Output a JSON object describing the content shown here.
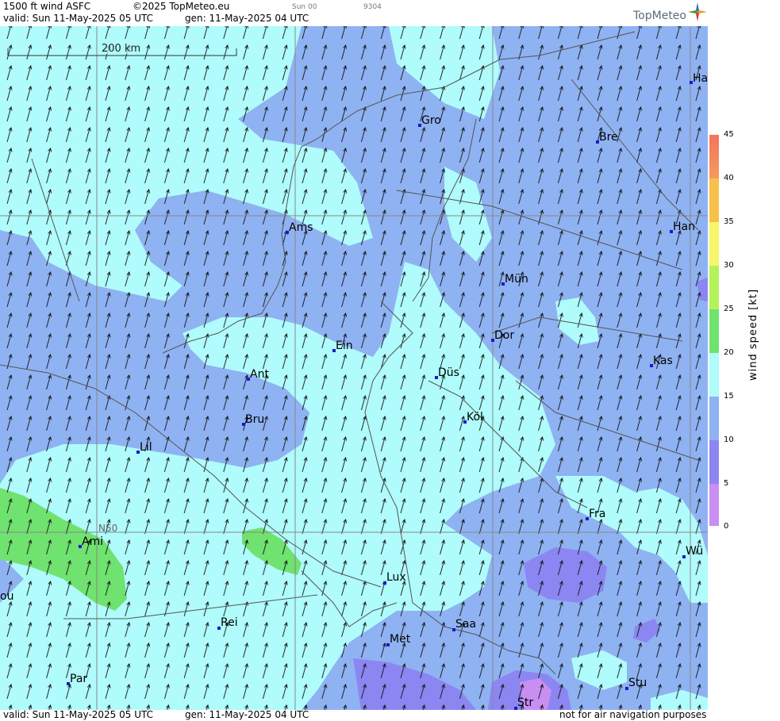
{
  "header": {
    "product": "1500 ft wind ASFC",
    "copyright": "©2025 TopMeteo.eu",
    "time_code": "Sun 00",
    "code": "9304",
    "valid": "valid:  Sun  11-May-2025  05 UTC",
    "gen": "gen: 11-May-2025 04 UTC",
    "brand": "TopMeteo"
  },
  "map": {
    "scale_label": "200 km",
    "lat_label": "N50",
    "cities": [
      {
        "name": "Ha"
      },
      {
        "name": "Gro"
      },
      {
        "name": "Bre"
      },
      {
        "name": "Ams"
      },
      {
        "name": "Han"
      },
      {
        "name": "Mün"
      },
      {
        "name": "Dor"
      },
      {
        "name": "Ein"
      },
      {
        "name": "Kas"
      },
      {
        "name": "Ant"
      },
      {
        "name": "Düs"
      },
      {
        "name": "Bru"
      },
      {
        "name": "Köl"
      },
      {
        "name": "Lil"
      },
      {
        "name": "Fra"
      },
      {
        "name": "Ami"
      },
      {
        "name": "Wü"
      },
      {
        "name": "Lux"
      },
      {
        "name": "ou"
      },
      {
        "name": "Rei"
      },
      {
        "name": "Saa"
      },
      {
        "name": "Met"
      },
      {
        "name": "Par"
      },
      {
        "name": "Stu"
      },
      {
        "name": "Str"
      }
    ],
    "wind_direction": "southerly to south-southeasterly"
  },
  "footer": {
    "valid": "valid:  Sun  11-May-2025  05 UTC",
    "gen": "gen: 11-May-2025 04 UTC",
    "disclaimer": "not for air navigation purposes"
  },
  "legend": {
    "title": "wind  speed  [kt]",
    "ticks": [
      "45",
      "40",
      "35",
      "30",
      "25",
      "20",
      "15",
      "10",
      "5",
      "0"
    ],
    "colors": {
      "0-5": "#c88ef2",
      "5-10": "#8c86f2",
      "10-15": "#8fb2f2",
      "15-20": "#b0fbfb",
      "20-25": "#6fe26f",
      "25-30": "#b4f25a",
      "30-35": "#f6f66a",
      "35-40": "#f6c14a",
      "40-45": "#f69a5a",
      "45+": "#f27560"
    }
  }
}
